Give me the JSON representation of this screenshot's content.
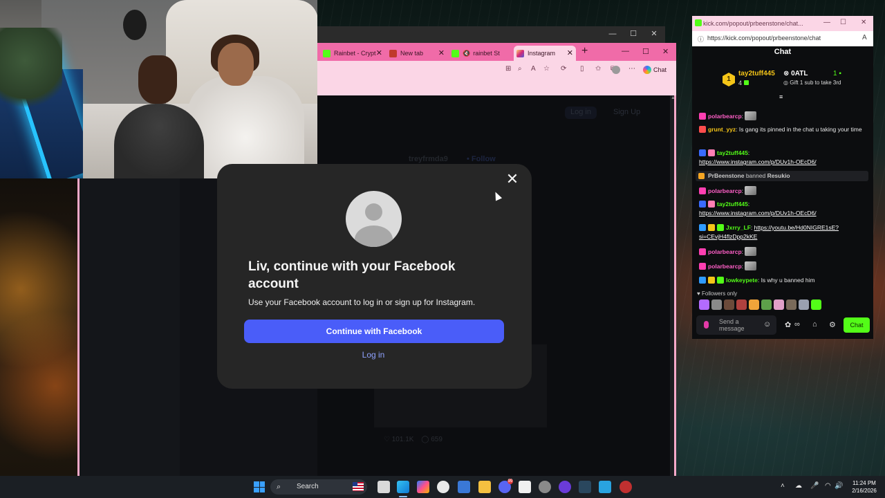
{
  "browser": {
    "tabs": [
      {
        "label": "Rainbet - Crypt",
        "favicon_color": "#53fc18",
        "active": false
      },
      {
        "label": "New tab",
        "favicon_color": "#c0392b",
        "active": false
      },
      {
        "label": "rainbet St",
        "favicon_color": "#53fc18",
        "active": false
      },
      {
        "label": "Instagram",
        "favicon_color": "#d62976",
        "active": true
      }
    ],
    "new_tab": "+",
    "copilot_label": "Chat",
    "accent": "#f06ba8"
  },
  "instagram_page": {
    "login_btn": "Log in",
    "signup_btn": "Sign Up",
    "username": "treyfrmda9",
    "follow": "• Follow",
    "likes": "101.1K",
    "comments": "659"
  },
  "modal": {
    "title": "Liv, continue with your Facebook account",
    "subtitle": "Use your Facebook account to log in or sign up for Instagram.",
    "primary_button": "Continue with Facebook",
    "secondary_link": "Log in",
    "close_glyph": "✕",
    "primary_color": "#4a5df9"
  },
  "kick_chat": {
    "window_title": "kick.com/popout/prbeenstone/chat...",
    "url": "https://kick.com/popout/prbeenstone/chat",
    "header": "Chat",
    "pinned": {
      "rank": "1",
      "name": "tay2tuff445",
      "count": "4",
      "team": "0ATL",
      "team_num": "1",
      "gift_text": "Gift 1 sub to take 3rd"
    },
    "messages": [
      {
        "user": "polarbearcp",
        "user_color": "#ff5fc7",
        "text": ""
      },
      {
        "user": "grunt_yyz",
        "user_color": "#f5c518",
        "text": "Is gang its pinned in the chat u taking your time"
      },
      {
        "user": "tay2tuff445",
        "user_color": "#53fc18",
        "text": "",
        "link": "https://www.instagram.com/p/DUv1h-OEcD6/"
      },
      {
        "system": true,
        "actor": "PrBeenstone",
        "action": "banned",
        "target": "Resukio"
      },
      {
        "user": "polarbearcp",
        "user_color": "#ff5fc7",
        "text": ""
      },
      {
        "user": "tay2tuff445",
        "user_color": "#53fc18",
        "text": "",
        "link": "https://www.instagram.com/p/DUv1h-OEcD6/"
      },
      {
        "user": "Jxrry_LF",
        "user_color": "#53fc18",
        "text": "",
        "link": "https://youtu.be/Hd0NIGRE1sE?si=CEvjH4flzDpp2kKE"
      },
      {
        "user": "polarbearcp",
        "user_color": "#ff5fc7",
        "text": ""
      },
      {
        "user": "polarbearcp",
        "user_color": "#ff5fc7",
        "text": ""
      },
      {
        "user": "lowkeypete",
        "user_color": "#53fc18",
        "text": "Is why u banned him"
      }
    ],
    "followers_only": "Followers only",
    "input_placeholder": "Send a message",
    "send_button": "Chat",
    "accent": "#53fc18"
  },
  "taskbar": {
    "search_placeholder": "Search",
    "time": "11:24 PM",
    "date": "2/16/2026",
    "notification_count": "99"
  }
}
